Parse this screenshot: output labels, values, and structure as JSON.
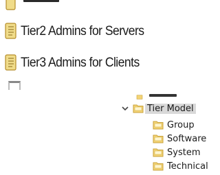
{
  "top_list": {
    "items": [
      {
        "label": "Tier2 Admins for Servers",
        "icon": "script-icon"
      },
      {
        "label": "Tier3 Admins for Clients",
        "icon": "script-icon"
      }
    ]
  },
  "tree": {
    "parent_label": "Tier Model",
    "parent_expanded": true,
    "children": [
      {
        "label": "Group",
        "icon": "folder-icon"
      },
      {
        "label": "Software",
        "icon": "folder-icon"
      },
      {
        "label": "System",
        "icon": "folder-icon"
      },
      {
        "label": "Technical",
        "icon": "folder-icon"
      }
    ]
  },
  "colors": {
    "folder_fill": "#f3d476",
    "folder_edge": "#c9a23a",
    "selection": "#d9d9d9",
    "scroll_fill": "#f0dc8a",
    "scroll_edge": "#b58d2a"
  }
}
